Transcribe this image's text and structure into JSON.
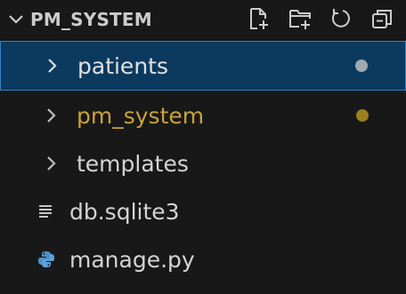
{
  "explorer": {
    "title": "PM_SYSTEM",
    "actions": [
      {
        "icon": "new-file-icon"
      },
      {
        "icon": "new-folder-icon"
      },
      {
        "icon": "refresh-icon"
      },
      {
        "icon": "collapse-all-icon"
      }
    ],
    "items": [
      {
        "label": "patients",
        "type": "folder",
        "color": "#e0e0e0",
        "dot_color": "#a0a8b0",
        "selected": true
      },
      {
        "label": "pm_system",
        "type": "folder",
        "color": "#c8a33a",
        "dot_color": "#9c7f1e",
        "selected": false
      },
      {
        "label": "templates",
        "type": "folder",
        "color": "#d4d4d4",
        "selected": false
      },
      {
        "label": "db.sqlite3",
        "type": "file",
        "icon": "text-file-icon",
        "color": "#d4d4d4",
        "selected": false
      },
      {
        "label": "manage.py",
        "type": "file",
        "icon": "python-icon",
        "color": "#d4d4d4",
        "selected": false
      }
    ]
  }
}
